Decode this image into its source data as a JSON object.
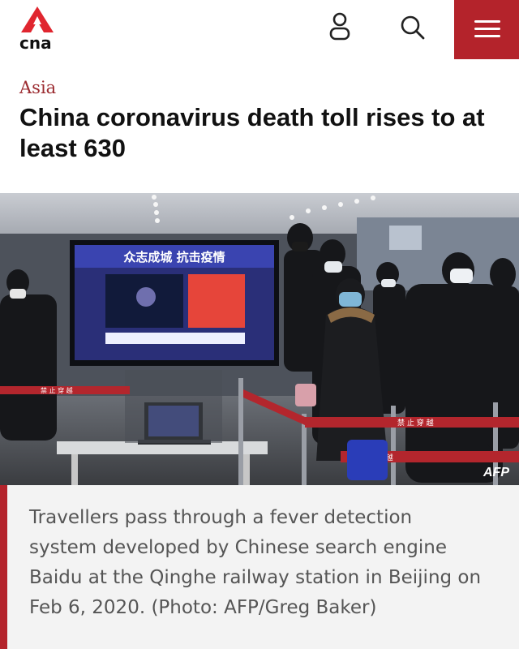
{
  "header": {
    "logo_text": "cna",
    "brand_color": "#b4232b",
    "icons": [
      "user-icon",
      "search-icon",
      "hamburger-menu-icon"
    ]
  },
  "article": {
    "section": "Asia",
    "headline": "China coronavirus death toll rises to at least 630",
    "photo": {
      "credit": "AFP",
      "screen_banner": "众志成城  抗击疫情",
      "barrier_text": "禁 止 穿 越"
    },
    "caption": "Travellers pass through a fever detection system developed by Chinese search engine Baidu at the Qinghe railway station in Beijing on Feb 6, 2020. (Photo: AFP/Greg Baker)"
  }
}
